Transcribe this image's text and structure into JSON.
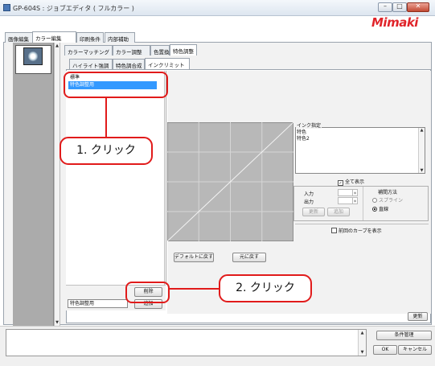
{
  "window": {
    "title": "GP-604S : ジョブエディタ ( フルカラー )",
    "logo": "Mimaki",
    "minimize_glyph": "–",
    "maximize_glyph": "□",
    "close_glyph": "✕"
  },
  "main_tabs": [
    {
      "label": "画像編集",
      "selected": false
    },
    {
      "label": "カラー編集",
      "selected": true
    },
    {
      "label": "印刷条件",
      "selected": false
    },
    {
      "label": "内部補助",
      "selected": false
    }
  ],
  "sub_tabs": [
    {
      "label": "カラーマッチング",
      "selected": false
    },
    {
      "label": "カラー調整",
      "selected": false
    },
    {
      "label": "色置換",
      "selected": false
    },
    {
      "label": "特色調整",
      "selected": true
    }
  ],
  "inner_tabs": [
    {
      "label": "ハイライト強調",
      "selected": false
    },
    {
      "label": "特色調合成",
      "selected": false
    },
    {
      "label": "インクリミット",
      "selected": true
    }
  ],
  "color_list": {
    "items": [
      "標準",
      "特色調整用"
    ],
    "selected_index": 1
  },
  "delete_label": "削除",
  "name_field_value": "特色調整用",
  "add_label": "追加",
  "graph": {
    "default_label": "デフォルトに戻す",
    "restore_label": "元に戻す"
  },
  "ink_panel": {
    "group_label": "インク指定",
    "inks": [
      "特色",
      "特色2"
    ],
    "show_all_label": "全て表示",
    "show_all_checked": true
  },
  "io": {
    "input_label": "入力",
    "output_label": "出力",
    "update_label": "更新",
    "add_label": "追加"
  },
  "interp": {
    "label": "補間方法",
    "options": [
      "スプライン",
      "直線"
    ],
    "selected_index": 1
  },
  "prev_curve_label": "前回のカーブを表示",
  "update_button_label": "更新",
  "bottom": {
    "cond_label": "条件管理",
    "ok_label": "OK",
    "cancel_label": "キャンセル"
  },
  "callouts": {
    "step1": "1. クリック",
    "step2": "2. クリック"
  },
  "colors": {
    "selection": "#3399ff",
    "callout": "#e11b1b",
    "logo": "#e0242a"
  }
}
